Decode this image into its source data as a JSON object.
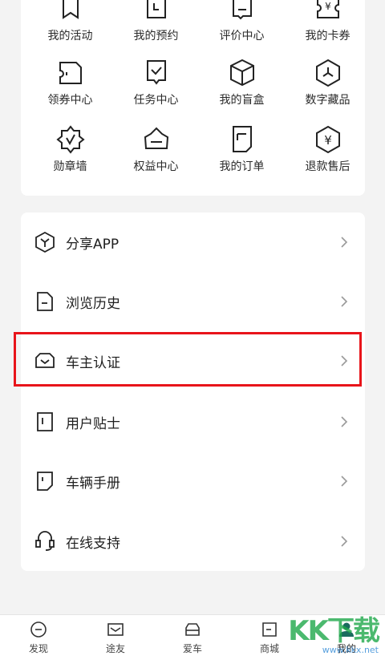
{
  "grid": [
    {
      "label": "我的活动",
      "icon": "bookmark-flag-icon"
    },
    {
      "label": "我的预约",
      "icon": "calendar-clock-icon"
    },
    {
      "label": "评价中心",
      "icon": "comment-icon"
    },
    {
      "label": "我的卡券",
      "icon": "coupon-yen-icon"
    },
    {
      "label": "领券中心",
      "icon": "ticket-icon"
    },
    {
      "label": "任务中心",
      "icon": "checklist-icon"
    },
    {
      "label": "我的盲盒",
      "icon": "box-icon"
    },
    {
      "label": "数字藏品",
      "icon": "hexagon-collectible-icon"
    },
    {
      "label": "勋章墙",
      "icon": "medal-icon"
    },
    {
      "label": "权益中心",
      "icon": "crown-icon"
    },
    {
      "label": "我的订单",
      "icon": "order-icon"
    },
    {
      "label": "退款售后",
      "icon": "refund-yen-icon"
    }
  ],
  "list": [
    {
      "label": "分享APP",
      "icon": "share-hexagon-icon"
    },
    {
      "label": "浏览历史",
      "icon": "history-doc-icon"
    },
    {
      "label": "车主认证",
      "icon": "car-owner-icon"
    },
    {
      "label": "用户贴士",
      "icon": "tips-icon"
    },
    {
      "label": "车辆手册",
      "icon": "manual-icon"
    },
    {
      "label": "在线支持",
      "icon": "headset-icon"
    }
  ],
  "tabs": [
    {
      "label": "发现",
      "icon": "compass-icon"
    },
    {
      "label": "途友",
      "icon": "mail-icon"
    },
    {
      "label": "爱车",
      "icon": "car-icon"
    },
    {
      "label": "商城",
      "icon": "store-icon"
    },
    {
      "label": "我的",
      "icon": "user-icon",
      "active": true
    }
  ],
  "watermark": {
    "logo": "KK下载",
    "url": "www.kkx.net"
  },
  "colors": {
    "highlight": "#e8141a",
    "accent": "#1a6b5e"
  }
}
